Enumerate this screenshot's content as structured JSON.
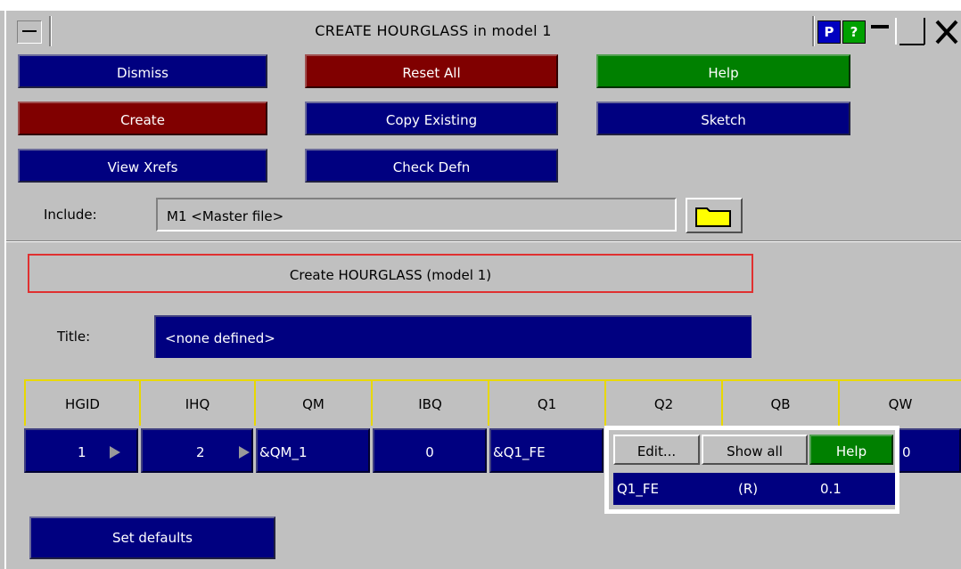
{
  "window": {
    "title": "CREATE HOURGLASS in model 1",
    "p_button": "P",
    "help_button": "?"
  },
  "buttons": {
    "dismiss": "Dismiss",
    "reset_all": "Reset All",
    "help": "Help",
    "create": "Create",
    "copy_existing": "Copy Existing",
    "sketch": "Sketch",
    "view_xrefs": "View Xrefs",
    "check_defn": "Check Defn",
    "set_defaults": "Set defaults"
  },
  "include": {
    "label": "Include:",
    "value": "M1  <Master file>"
  },
  "form": {
    "header": "Create HOURGLASS (model 1)",
    "title_label": "Title:",
    "title_value": "<none defined>"
  },
  "grid": {
    "columns": [
      "HGID",
      "IHQ",
      "QM",
      "IBQ",
      "Q1",
      "Q2",
      "QB",
      "QW"
    ],
    "row": {
      "HGID": "1",
      "IHQ": "2",
      "QM": "&QM_1",
      "IBQ": "0",
      "Q1": "&Q1_FE",
      "QW_partial": "0"
    }
  },
  "popup": {
    "edit": "Edit...",
    "show_all": "Show all",
    "help": "Help",
    "param_name": "Q1_FE",
    "param_type": "(R)",
    "param_value": "0.1"
  },
  "colors": {
    "panel": "#c0c0c0",
    "button_blue": "#000080",
    "button_red": "#800000",
    "button_green": "#008000",
    "grid_border": "#e8d800",
    "frame_red": "#e03030"
  }
}
